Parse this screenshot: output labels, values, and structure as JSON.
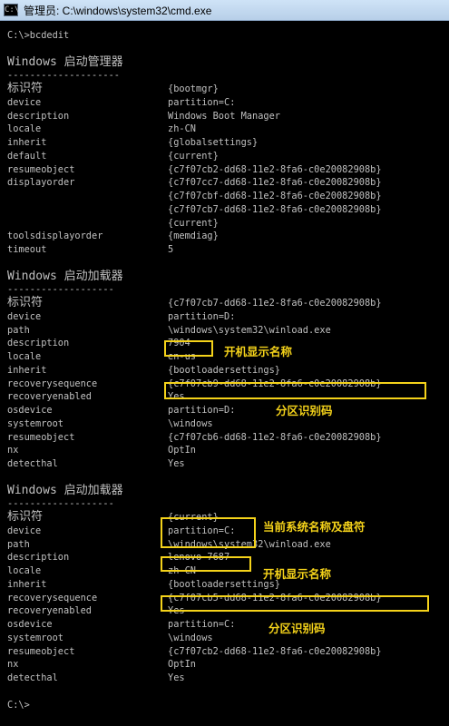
{
  "window": {
    "title": "管理员: C:\\windows\\system32\\cmd.exe",
    "icon": "cmd-icon"
  },
  "console": {
    "prompt_command": "C:\\>bcdedit",
    "bootmgr_section": {
      "header": "Windows 启动管理器",
      "divider": "--------------------",
      "rows": [
        {
          "key": "标识符",
          "value": "{bootmgr}"
        },
        {
          "key": "device",
          "value": "partition=C:"
        },
        {
          "key": "description",
          "value": "Windows Boot Manager"
        },
        {
          "key": "locale",
          "value": "zh-CN"
        },
        {
          "key": "inherit",
          "value": "{globalsettings}"
        },
        {
          "key": "default",
          "value": "{current}"
        },
        {
          "key": "resumeobject",
          "value": "{c7f07cb2-dd68-11e2-8fa6-c0e20082908b}"
        },
        {
          "key": "displayorder",
          "value": "{c7f07cc7-dd68-11e2-8fa6-c0e20082908b}"
        },
        {
          "key": "",
          "value": "{c7f07cbf-dd68-11e2-8fa6-c0e20082908b}"
        },
        {
          "key": "",
          "value": "{c7f07cb7-dd68-11e2-8fa6-c0e20082908b}"
        },
        {
          "key": "",
          "value": "{current}"
        },
        {
          "key": "toolsdisplayorder",
          "value": "{memdiag}"
        },
        {
          "key": "timeout",
          "value": "5"
        }
      ]
    },
    "loader1_section": {
      "header": "Windows 启动加载器",
      "divider": "-------------------",
      "rows": [
        {
          "key": "标识符",
          "value": "{c7f07cb7-dd68-11e2-8fa6-c0e20082908b}"
        },
        {
          "key": "device",
          "value": "partition=D:"
        },
        {
          "key": "path",
          "value": "\\windows\\system32\\winload.exe"
        },
        {
          "key": "description",
          "value": "7904"
        },
        {
          "key": "locale",
          "value": "en-us"
        },
        {
          "key": "inherit",
          "value": "{bootloadersettings}"
        },
        {
          "key": "recoverysequence",
          "value": "{c7f07cb9-dd68-11e2-8fa6-c0e20082908b}"
        },
        {
          "key": "recoveryenabled",
          "value": "Yes"
        },
        {
          "key": "osdevice",
          "value": "partition=D:"
        },
        {
          "key": "systemroot",
          "value": "\\windows"
        },
        {
          "key": "resumeobject",
          "value": "{c7f07cb6-dd68-11e2-8fa6-c0e20082908b}"
        },
        {
          "key": "nx",
          "value": "OptIn"
        },
        {
          "key": "detecthal",
          "value": "Yes"
        }
      ]
    },
    "loader2_section": {
      "header": "Windows 启动加载器",
      "divider": "-------------------",
      "rows": [
        {
          "key": "标识符",
          "value": "{current}"
        },
        {
          "key": "device",
          "value": "partition=C:"
        },
        {
          "key": "path",
          "value": "\\windows\\system32\\winload.exe"
        },
        {
          "key": "description",
          "value": "lenovo 7687"
        },
        {
          "key": "locale",
          "value": "zh-CN"
        },
        {
          "key": "inherit",
          "value": "{bootloadersettings}"
        },
        {
          "key": "recoverysequence",
          "value": "{c7f07cb5-dd68-11e2-8fa6-c0e20082908b}"
        },
        {
          "key": "recoveryenabled",
          "value": "Yes"
        },
        {
          "key": "osdevice",
          "value": "partition=C:"
        },
        {
          "key": "systemroot",
          "value": "\\windows"
        },
        {
          "key": "resumeobject",
          "value": "{c7f07cb2-dd68-11e2-8fa6-c0e20082908b}"
        },
        {
          "key": "nx",
          "value": "OptIn"
        },
        {
          "key": "detecthal",
          "value": "Yes"
        }
      ]
    },
    "final_prompt": "C:\\>"
  },
  "annotations": {
    "note1": "开机显示名称",
    "note2": "分区识别码",
    "note3": "当前系统名称及盘符",
    "note4": "开机显示名称",
    "note5": "分区识别码",
    "color": "#f4d21a"
  }
}
